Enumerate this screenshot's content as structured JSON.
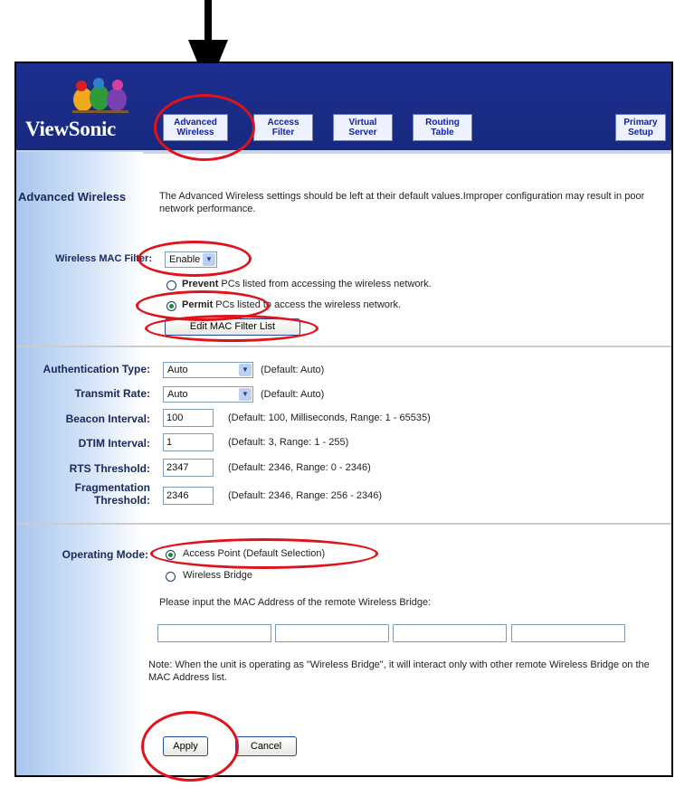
{
  "brand": {
    "logo_text": "ViewSonic",
    "colors": {
      "header": "#1d2f8f",
      "tab_text": "#0f23a8",
      "annotation": "#e0131b",
      "radio_selected": "#1e8a2b"
    }
  },
  "tabs": [
    {
      "label_line1": "Advanced",
      "label_line2": "Wireless"
    },
    {
      "label_line1": "Access",
      "label_line2": "Filter"
    },
    {
      "label_line1": "Virtual",
      "label_line2": "Server"
    },
    {
      "label_line1": "Routing",
      "label_line2": "Table"
    },
    {
      "label_line1": "Primary",
      "label_line2": "Setup"
    }
  ],
  "page": {
    "title": "Advanced Wireless",
    "description": "The Advanced Wireless settings should be left at their default values.Improper configuration may result in poor network performance."
  },
  "mac_filter": {
    "label": "Wireless MAC Filter:",
    "value": "Enable",
    "prevent_bold": "Prevent",
    "prevent_rest": " PCs listed from accessing the wireless network.",
    "permit_bold": "Permit",
    "permit_rest": " PCs listed to access the wireless network.",
    "edit_button": "Edit MAC Filter List"
  },
  "settings": {
    "auth_type": {
      "label": "Authentication Type:",
      "value": "Auto",
      "hint": "(Default: Auto)"
    },
    "transmit_rate": {
      "label": "Transmit Rate:",
      "value": "Auto",
      "hint": "(Default: Auto)"
    },
    "beacon_interval": {
      "label": "Beacon Interval:",
      "value": "100",
      "hint": "(Default: 100, Milliseconds, Range: 1 - 65535)"
    },
    "dtim_interval": {
      "label": "DTIM Interval:",
      "value": "1",
      "hint": "(Default: 3, Range: 1 - 255)"
    },
    "rts_threshold": {
      "label": "RTS Threshold:",
      "value": "2347",
      "hint": "(Default: 2346, Range: 0 - 2346)"
    },
    "frag_threshold": {
      "label_line1": "Fragmentation",
      "label_line2": "Threshold:",
      "value": "2346",
      "hint": "(Default: 2346, Range: 256 - 2346)"
    }
  },
  "operating_mode": {
    "label": "Operating Mode:",
    "option_ap": "Access Point (Default Selection)",
    "option_bridge": "Wireless Bridge",
    "mac_prompt": "Please input the MAC Address of the remote Wireless Bridge:",
    "mac_fields": [
      "",
      "",
      "",
      ""
    ],
    "note": "Note: When the unit is operating as \"Wireless Bridge\", it will interact only with other remote Wireless Bridge on the MAC Address list."
  },
  "actions": {
    "apply": "Apply",
    "cancel": "Cancel"
  }
}
